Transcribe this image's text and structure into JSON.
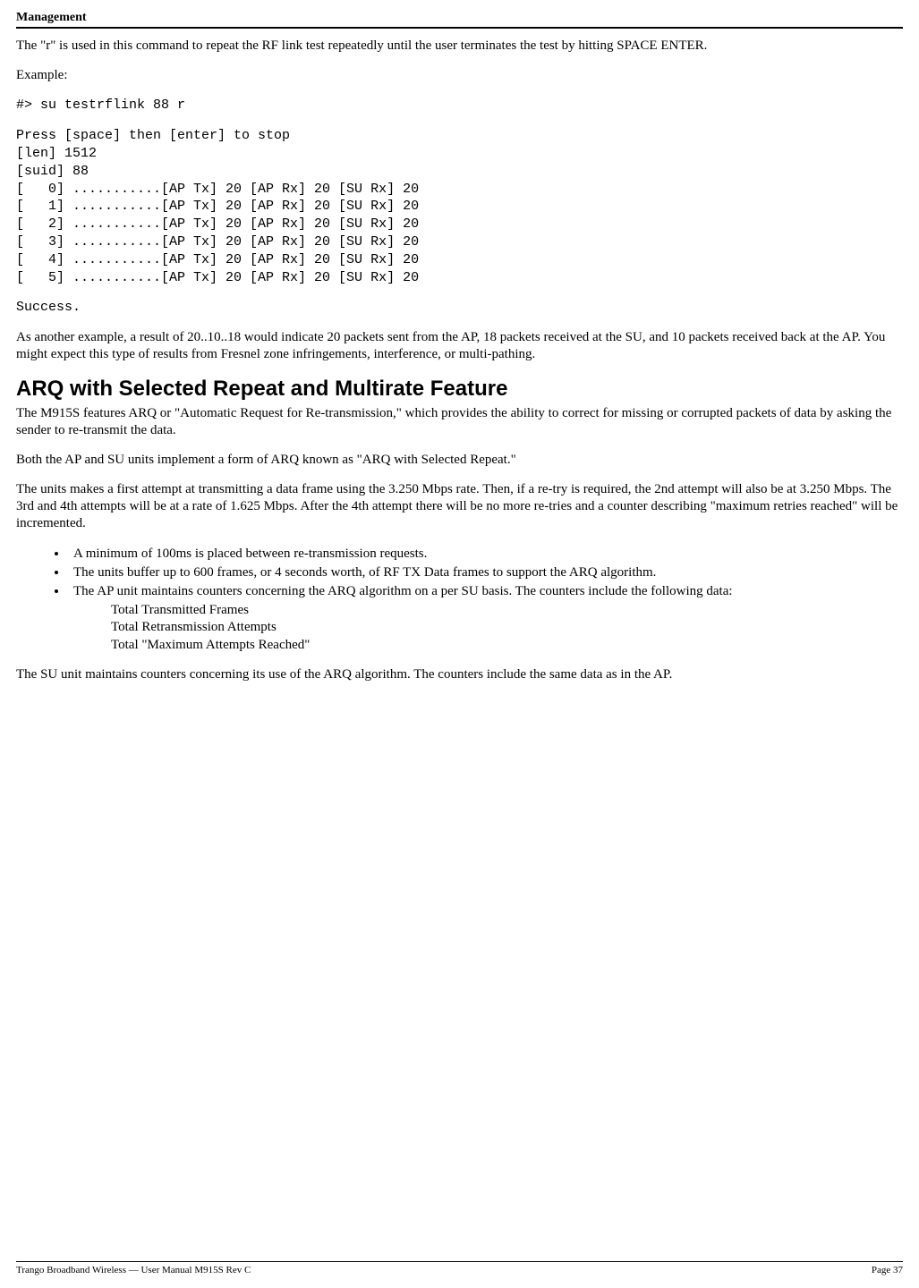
{
  "header": {
    "title": "Management"
  },
  "para1": "The \"r\" is used in this command to repeat the RF link test repeatedly until the user terminates the test by hitting SPACE ENTER.",
  "example_label": "Example:",
  "cmd_line": "#> su testrflink 88 r",
  "terminal": "Press [space] then [enter] to stop\n[len] 1512\n[suid] 88\n[   0] ...........[AP Tx] 20 [AP Rx] 20 [SU Rx] 20\n[   1] ...........[AP Tx] 20 [AP Rx] 20 [SU Rx] 20\n[   2] ...........[AP Tx] 20 [AP Rx] 20 [SU Rx] 20\n[   3] ...........[AP Tx] 20 [AP Rx] 20 [SU Rx] 20\n[   4] ...........[AP Tx] 20 [AP Rx] 20 [SU Rx] 20\n[   5] ...........[AP Tx] 20 [AP Rx] 20 [SU Rx] 20",
  "success": "Success.",
  "para2": "As another example, a result of 20..10..18 would indicate 20 packets sent from the AP, 18 packets received at the SU, and 10 packets received back at the AP.  You might expect this type of results from Fresnel zone infringements, interference, or multi-pathing.",
  "section_heading": "ARQ with Selected Repeat and Multirate Feature",
  "para3": "The M915S features ARQ or  \"Automatic Request for Re-transmission,\" which provides the ability to correct for missing or corrupted packets of data by asking the sender to re-transmit the data.",
  "para4": "Both the AP and SU units implement a form of ARQ known as \"ARQ with Selected Repeat.\"",
  "para5": "The units makes a first attempt at transmitting a data frame using the 3.250 Mbps rate.  Then, if a re-try is required, the 2nd attempt will also be at 3.250 Mbps.  The 3rd and 4th attempts will be at a rate of 1.625 Mbps.  After the 4th attempt there will be no more re-tries and a counter describing \"maximum retries reached\" will be incremented.",
  "bullets": [
    "A minimum of 100ms is placed between re-transmission requests.",
    "The units buffer up to 600 frames, or 4 seconds worth, of RF TX Data frames to support the ARQ algorithm.",
    "The AP unit maintains counters concerning the ARQ algorithm on a per SU basis.  The counters include the following data:"
  ],
  "sublist": [
    "Total Transmitted Frames",
    "Total Retransmission Attempts",
    "Total \"Maximum Attempts Reached\""
  ],
  "para6": "The SU unit maintains counters concerning its use of the ARQ algorithm.  The counters include the same data as in the AP.",
  "footer": {
    "left": "Trango Broadband Wireless — User Manual M915S Rev C",
    "right": "Page 37"
  }
}
